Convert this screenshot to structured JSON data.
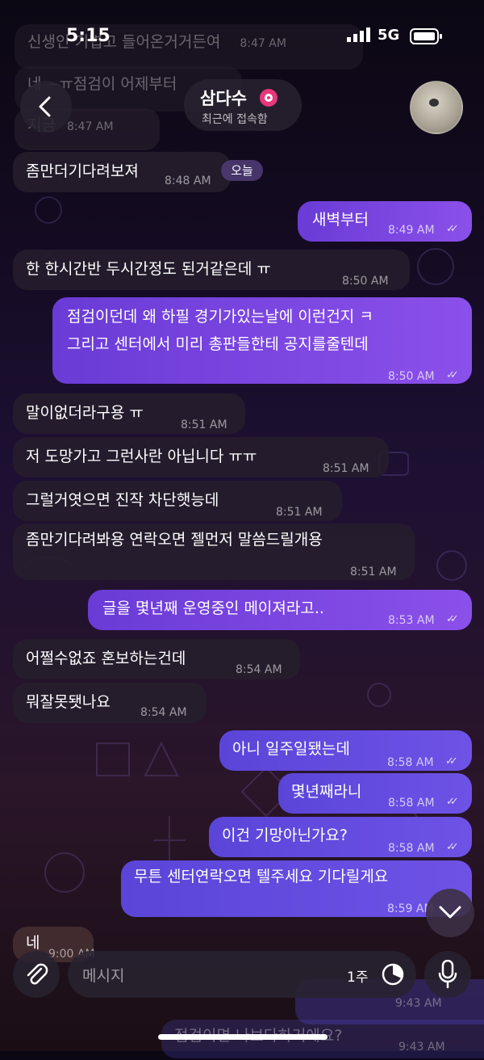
{
  "status_bar": {
    "time": "5:15",
    "network": "5G"
  },
  "header": {
    "contact_name": "삼다수",
    "contact_status": "최근에 접속함"
  },
  "day_badge": "오늘",
  "faded_top": [
    {
      "text": "신생인 기볍고 들어온거거든여",
      "time": "8:47 AM"
    },
    {
      "text": "네 ~ㅠ점검이 어제부터",
      "time": ""
    },
    {
      "text": "지금",
      "time": "8:47 AM"
    }
  ],
  "messages": [
    {
      "text": "좀만더기다려보져",
      "time": "8:48 AM",
      "out": false
    },
    {
      "text": "새벽부터",
      "time": "8:49 AM",
      "out": true
    },
    {
      "text": "한 한시간반 두시간정도 된거같은데 ㅠ",
      "time": "8:50 AM",
      "out": false
    },
    {
      "line1": "점검이던데 왜 하필 경기가있는날에 이런건지 ㅋ",
      "line2": "그리고 센터에서 미리 총판들한테 공지를줄텐데",
      "time": "8:50 AM",
      "out": true
    },
    {
      "text": "말이없더라구용 ㅠ",
      "time": "8:51 AM",
      "out": false
    },
    {
      "text": "저 도망가고 그런사란 아닙니다 ㅠㅠ",
      "time": "8:51 AM",
      "out": false
    },
    {
      "text": "그럴거엿으면 진작 차단햇능데",
      "time": "8:51 AM",
      "out": false
    },
    {
      "text": "좀만기다려봐용 연락오면 젤먼저 말씀드릴개용",
      "time": "8:51 AM",
      "out": false
    },
    {
      "text": "글을 몇년째 운영중인 메이져라고..",
      "time": "8:53 AM",
      "out": true
    },
    {
      "text": "어쩔수없죠 혼보하는건데",
      "time": "8:54 AM",
      "out": false
    },
    {
      "text": "뭐잘못됏나요",
      "time": "8:54 AM",
      "out": false
    },
    {
      "text": "아니 일주일됐는데",
      "time": "8:58 AM",
      "out": true
    },
    {
      "text": "몇년째라니",
      "time": "8:58 AM",
      "out": true
    },
    {
      "text": "이건 기망아닌가요?",
      "time": "8:58 AM",
      "out": true
    },
    {
      "text": "무튼 센터연락오면 텔주세요 기다릴게요",
      "time": "8:59 AM",
      "out": true
    },
    {
      "text": "네",
      "time": "9:00 AM",
      "out": false
    }
  ],
  "faded_bottom": [
    {
      "text": "9:43 AM"
    },
    {
      "text": "점검이면 나보다하거에요?",
      "time": "9:43 AM"
    }
  ],
  "composer": {
    "placeholder": "메시지",
    "timer": "1주"
  },
  "icons": {
    "back": "chevron-left-icon",
    "scroll": "chevron-down-icon",
    "attach": "paperclip-icon",
    "timer": "timer-icon",
    "mic": "microphone-icon"
  }
}
